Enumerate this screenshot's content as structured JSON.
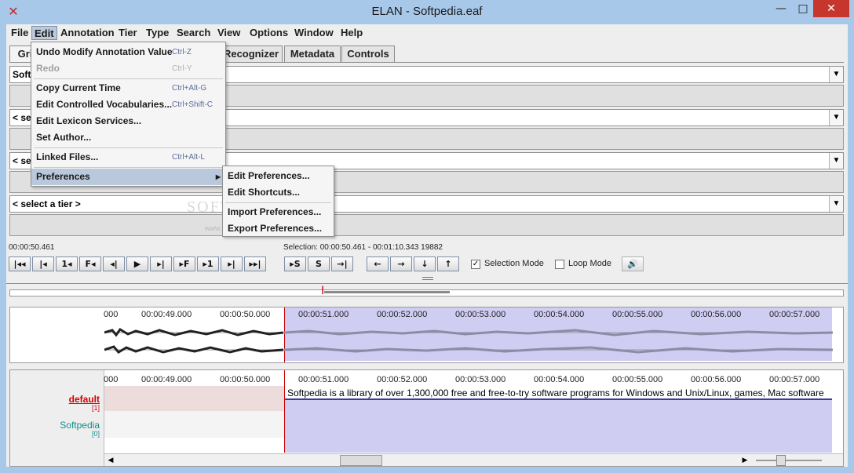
{
  "window": {
    "title": "ELAN - Softpedia.eaf",
    "minimize": "—",
    "maximize": "□",
    "close": "✕"
  },
  "menubar": {
    "items": [
      "File",
      "Edit",
      "Annotation",
      "Tier",
      "Type",
      "Search",
      "View",
      "Options",
      "Window",
      "Help"
    ],
    "active": "Edit"
  },
  "tabs": {
    "items": [
      "Gri",
      "Recognizer",
      "Metadata",
      "Controls"
    ]
  },
  "tier_selects": {
    "first": "Softp",
    "second": "< se",
    "third": "< se",
    "fourth": "< select a tier >"
  },
  "edit_menu": {
    "items": [
      {
        "label": "Undo Modify Annotation Value",
        "shortcut": "Ctrl-Z",
        "enabled": true
      },
      {
        "label": "Redo",
        "shortcut": "Ctrl-Y",
        "enabled": false
      },
      {
        "label": "Copy Current Time",
        "shortcut": "Ctrl+Alt-G",
        "enabled": true
      },
      {
        "label": "Edit Controlled Vocabularies...",
        "shortcut": "Ctrl+Shift-C",
        "enabled": true
      },
      {
        "label": "Edit Lexicon Services...",
        "shortcut": "",
        "enabled": true
      },
      {
        "label": "Set Author...",
        "shortcut": "",
        "enabled": true
      },
      {
        "label": "Linked Files...",
        "shortcut": "Ctrl+Alt-L",
        "enabled": true
      },
      {
        "label": "Preferences",
        "shortcut": "",
        "enabled": true,
        "submenu": true
      }
    ]
  },
  "preferences_submenu": {
    "items": [
      "Edit Preferences...",
      "Edit Shortcuts...",
      "Import Preferences...",
      "Export Preferences..."
    ]
  },
  "watermark": {
    "text": "SOFTPEDIA",
    "url": "www.softpedia.com"
  },
  "media": {
    "current_time": "00:00:50.461",
    "selection": "Selection: 00:00:50.461 - 00:01:10.343  19882"
  },
  "player_buttons": [
    "|◂◂",
    "|◂",
    "1◂",
    "F◂",
    "◂|",
    "▶",
    "▸|",
    "▸F",
    "▸1",
    "▸|",
    "▸▸|"
  ],
  "selection_buttons": [
    "▸S",
    "S",
    "→|"
  ],
  "nav_buttons": [
    "←",
    "→",
    "↓",
    "↑"
  ],
  "options": {
    "selection_mode": {
      "label": "Selection Mode",
      "checked": true
    },
    "loop_mode": {
      "label": "Loop Mode",
      "checked": false
    },
    "volume_icon": "speaker-icon"
  },
  "ruler": {
    "labels": [
      "000",
      "00:00:49.000",
      "00:00:50.000",
      "00:00:51.000",
      "00:00:52.000",
      "00:00:53.000",
      "00:00:54.000",
      "00:00:55.000",
      "00:00:56.000",
      "00:00:57.000"
    ]
  },
  "tiers": [
    {
      "name": "default",
      "count": "[1]",
      "color": "#d40000"
    },
    {
      "name": "Softpedia",
      "count": "[0]",
      "color": "#0f8f8a"
    }
  ],
  "annotation_text": "Softpedia is a library of over 1,300,000 free and free-to-try software programs for Windows and Unix/Linux, games, Mac software"
}
